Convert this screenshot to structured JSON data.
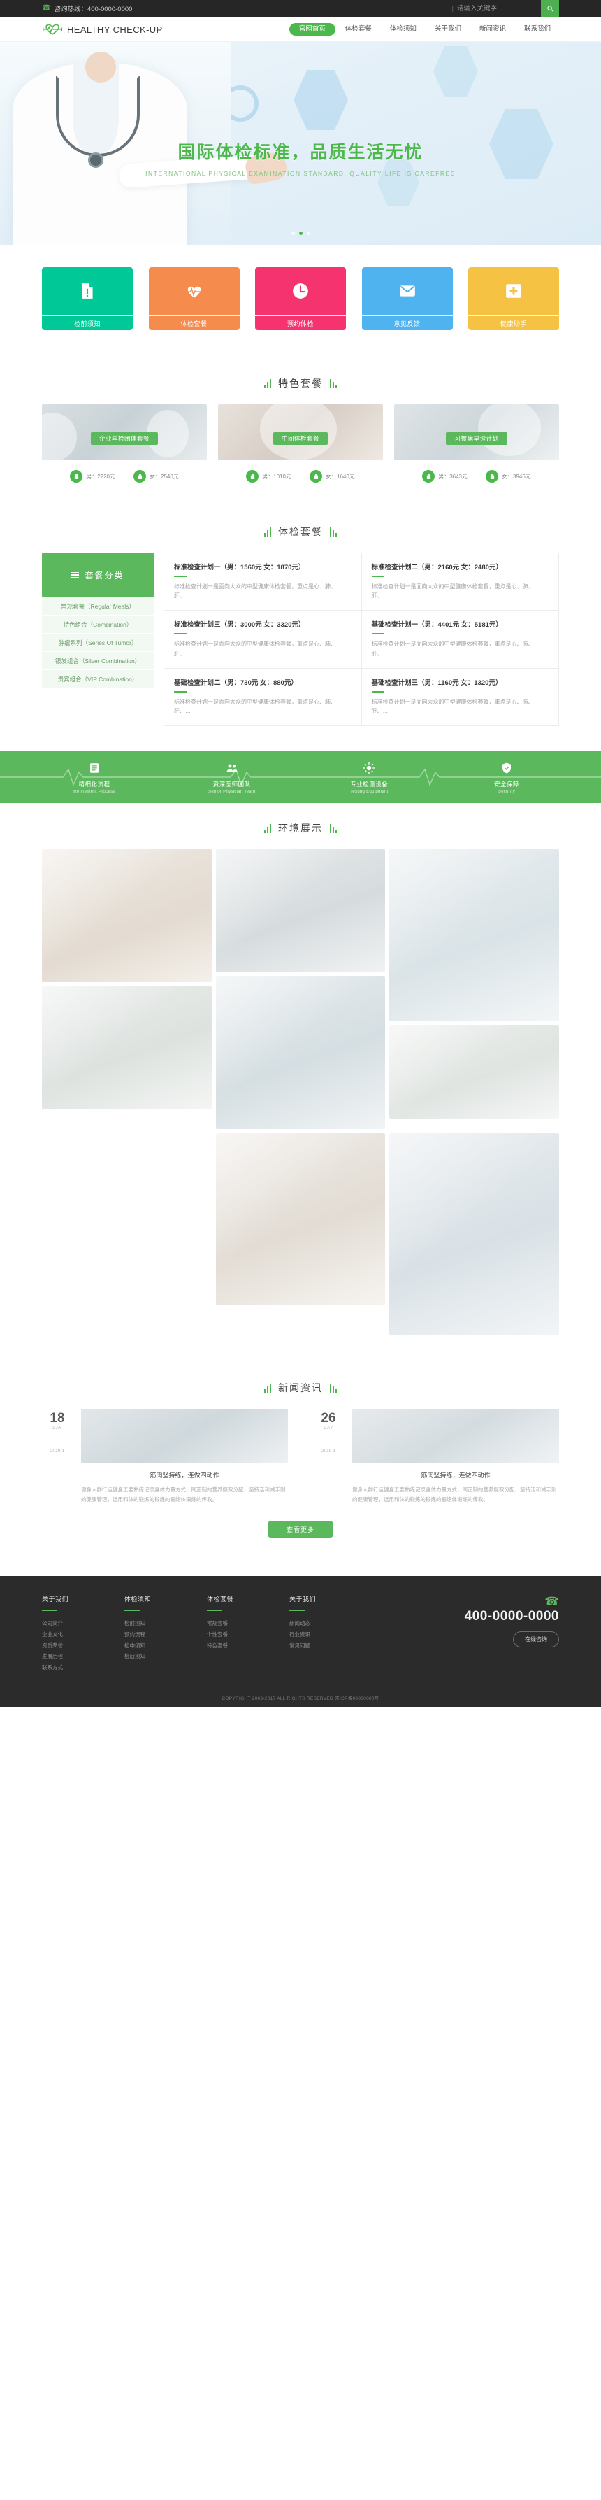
{
  "topbar": {
    "hotline_label": "咨询热线：400-0000-0000",
    "separator": "|",
    "search_placeholder": "请输入关键字",
    "search_value": "",
    "search_icon": "search-icon"
  },
  "header": {
    "logo_text": "HEALTHY CHECK-UP",
    "logo_icon": "heartbeat-logo-icon",
    "nav": [
      {
        "label": "官网首页",
        "active": true
      },
      {
        "label": "体检套餐",
        "active": false
      },
      {
        "label": "体检须知",
        "active": false
      },
      {
        "label": "关于我们",
        "active": false
      },
      {
        "label": "新闻资讯",
        "active": false
      },
      {
        "label": "联系我们",
        "active": false
      }
    ]
  },
  "banner": {
    "title": "国际体检标准，品质生活无忧",
    "subtitle": "INTERNATIONAL PHYSICAL EXAMINATION STANDARD, QUALITY LIFE IS CAREFREE",
    "dots": 3,
    "active_dot": 1,
    "accent_color": "#4cb84c"
  },
  "quick_cards": [
    {
      "label": "检前须知",
      "color": "#00c896",
      "icon": "document-alert-icon"
    },
    {
      "label": "体检套餐",
      "color": "#f68b4e",
      "icon": "heart-pulse-icon"
    },
    {
      "label": "预约体检",
      "color": "#f5336f",
      "icon": "clock-icon"
    },
    {
      "label": "意见反馈",
      "color": "#4fb3f0",
      "icon": "envelope-icon"
    },
    {
      "label": "健康助手",
      "color": "#f5c243",
      "icon": "medical-cross-icon"
    }
  ],
  "featured": {
    "section_title": "特色套餐",
    "items": [
      {
        "badge": "企业年检团体套餐",
        "male_label": "男：2220元",
        "female_label": "女：2540元"
      },
      {
        "badge": "中间体检套餐",
        "male_label": "男：1010元",
        "female_label": "女：1640元"
      },
      {
        "badge": "习惯病早诊计划",
        "male_label": "男：3643元",
        "female_label": "女：3946元"
      }
    ]
  },
  "packages": {
    "section_title": "体检套餐",
    "sidebar_title": "套餐分类",
    "sidebar_icon": "hamburger-icon",
    "categories": [
      "常规套餐（Regular Meals）",
      "特色组合（Combination）",
      "肿瘤系列（Series Of Tumor）",
      "银发组合（Silver Combination）",
      "贵宾组合（VIP Combination）"
    ],
    "cells": [
      {
        "title": "标准检查计划一（男：1560元 女：1870元）",
        "desc": "标准检查计划一是面向大众的中型健康体检套餐，重点是心、肺、肝、…"
      },
      {
        "title": "标准检查计划二（男：2160元 女：2480元）",
        "desc": "标准检查计划一是面向大众的中型健康体检套餐，重点是心、肺、肝、…"
      },
      {
        "title": "标准检查计划三（男：3000元 女：3320元）",
        "desc": "标准检查计划一是面向大众的中型健康体检套餐，重点是心、肺、肝、…"
      },
      {
        "title": "基础检查计划一（男：4401元 女：5181元）",
        "desc": "标准检查计划一是面向大众的中型健康体检套餐，重点是心、肺、肝、…"
      },
      {
        "title": "基础检查计划二（男：730元 女：880元）",
        "desc": "标准检查计划一是面向大众的中型健康体检套餐，重点是心、肺、肝、…"
      },
      {
        "title": "基础检查计划三（男：1160元 女：1320元）",
        "desc": "标准检查计划一是面向大众的中型健康体检套餐，重点是心、肺、肝、…"
      }
    ]
  },
  "strip": {
    "background": "#5cb85c",
    "items": [
      {
        "icon": "list-icon",
        "name": "精细化流程",
        "en": "Refinement Process"
      },
      {
        "icon": "team-icon",
        "name": "资深医师团队",
        "en": "Senior Physician Team"
      },
      {
        "icon": "equipment-icon",
        "name": "专业检测设备",
        "en": "Testing Equipment"
      },
      {
        "icon": "shield-icon",
        "name": "安全保障",
        "en": "Security"
      }
    ]
  },
  "gallery": {
    "section_title": "环境展示",
    "tiles": [
      "g1",
      "g2",
      "g3",
      "g4",
      "g5",
      "g6",
      "g7",
      "g8"
    ]
  },
  "news": {
    "section_title": "新闻资讯",
    "items": [
      {
        "day": "18",
        "month": "DAY",
        "year": "2019-1",
        "title": "筋肉坚持练，连做四动作",
        "desc": "健身人群行运健身工要熟练记录身体力量方式，同正制的营养摄取分配，坚持活和减手别的健康管理，运用和体的锻炼的锻炼的锻炼体锻炼的传教。"
      },
      {
        "day": "26",
        "month": "DAY",
        "year": "2019-1",
        "title": "筋肉坚持练，连做四动作",
        "desc": "健身人群行运健身工要熟练记录身体力量方式，同正制的营养摄取分配，坚持活和减手别的健康管理，运用和体的锻炼的锻炼的锻炼体锻炼的传教。"
      }
    ],
    "more_label": "查看更多"
  },
  "footer": {
    "columns": [
      {
        "title": "关于我们",
        "links": [
          "公司简介",
          "企业文化",
          "资质荣誉",
          "发展历程",
          "联系方式"
        ]
      },
      {
        "title": "体检须知",
        "links": [
          "检前须知",
          "预约流程",
          "检中须知",
          "检后须知"
        ]
      },
      {
        "title": "体检套餐",
        "links": [
          "常规套餐",
          "个性套餐",
          "特色套餐"
        ]
      },
      {
        "title": "关于我们",
        "links": [
          "新闻动态",
          "行业资讯",
          "常见问题"
        ]
      }
    ],
    "phone_icon": "phone-icon",
    "phone": "400-0000-0000",
    "consult_label": "在线咨询",
    "copyright": "COPYRIGHT 2003-2017 ALL RIGHTS RESERVED 京ICP备00000000号"
  }
}
